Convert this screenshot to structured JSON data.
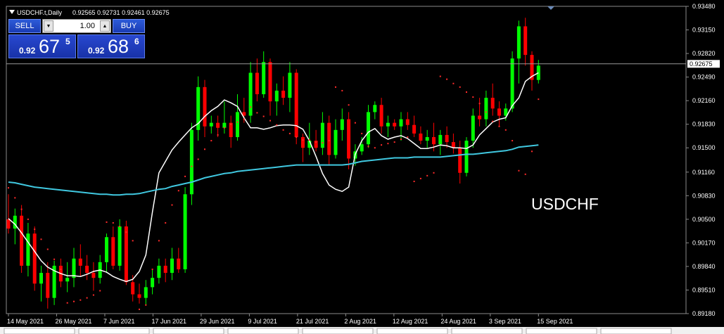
{
  "header": {
    "title": "USDCHF.t,Daily",
    "ohlc": "0.92565 0.92731 0.92461 0.92675"
  },
  "trade_panel": {
    "sell_label": "SELL",
    "buy_label": "BUY",
    "lot": "1.00",
    "sell_price": {
      "prefix": "0.92",
      "big": "67",
      "sup": "5"
    },
    "buy_price": {
      "prefix": "0.92",
      "big": "68",
      "sup": "6"
    }
  },
  "watermark": "USDCHF",
  "current_price_label": "0.92675",
  "colors": {
    "background": "#000000",
    "bull": "#00ff00",
    "bear": "#ff0000",
    "fast_ma": "#ffffff",
    "slow_ma": "#40c8e0",
    "sar": "#ff2a2a",
    "axis_text": "#ffffff"
  },
  "chart_data": {
    "type": "candlestick",
    "symbol": "USDCHF.t",
    "timeframe": "Daily",
    "ylim": [
      0.8918,
      0.9348
    ],
    "y_ticks": [
      "0.93480",
      "0.93150",
      "0.92820",
      "0.92490",
      "0.92160",
      "0.91830",
      "0.91500",
      "0.91160",
      "0.90830",
      "0.90500",
      "0.90170",
      "0.89840",
      "0.89510",
      "0.89180"
    ],
    "x_ticks": [
      "14 May 2021",
      "26 May 2021",
      "7 Jun 2021",
      "17 Jun 2021",
      "29 Jun 2021",
      "9 Jul 2021",
      "21 Jul 2021",
      "2 Aug 2021",
      "12 Aug 2021",
      "24 Aug 2021",
      "3 Sep 2021",
      "15 Sep 2021"
    ],
    "current_price": 0.92675,
    "series": [
      {
        "name": "fast_ma",
        "values": [
          0.9051,
          0.9043,
          0.9031,
          0.9018,
          0.9005,
          0.8992,
          0.8983,
          0.8978,
          0.8974,
          0.8971,
          0.8971,
          0.897,
          0.8973,
          0.8977,
          0.8979,
          0.8976,
          0.897,
          0.8966,
          0.8963,
          0.8966,
          0.8977,
          0.9,
          0.906,
          0.9115,
          0.9131,
          0.9147,
          0.9158,
          0.9168,
          0.9178,
          0.9184,
          0.9194,
          0.9202,
          0.9208,
          0.9217,
          0.9213,
          0.9208,
          0.9192,
          0.9178,
          0.9178,
          0.9176,
          0.9178,
          0.9181,
          0.9182,
          0.9182,
          0.9181,
          0.9176,
          0.916,
          0.9138,
          0.9114,
          0.9098,
          0.9092,
          0.9089,
          0.9095,
          0.9141,
          0.916,
          0.9172,
          0.9177,
          0.9167,
          0.9162,
          0.9165,
          0.9167,
          0.9163,
          0.9156,
          0.9149,
          0.9149,
          0.9151,
          0.9154,
          0.9153,
          0.915,
          0.915,
          0.9149,
          0.9154,
          0.9168,
          0.9177,
          0.9186,
          0.919,
          0.9192,
          0.9209,
          0.922,
          0.9243,
          0.925,
          0.9255
        ]
      },
      {
        "name": "slow_ma",
        "values": [
          0.9102,
          0.9101,
          0.9099,
          0.9097,
          0.9095,
          0.9094,
          0.9093,
          0.9092,
          0.9091,
          0.909,
          0.9089,
          0.9088,
          0.9087,
          0.9086,
          0.9085,
          0.9085,
          0.9084,
          0.9084,
          0.9085,
          0.9085,
          0.9086,
          0.9088,
          0.909,
          0.9092,
          0.9093,
          0.9096,
          0.9098,
          0.91,
          0.9102,
          0.9105,
          0.9108,
          0.911,
          0.9112,
          0.9114,
          0.9115,
          0.9117,
          0.9118,
          0.9119,
          0.912,
          0.9121,
          0.9122,
          0.9123,
          0.9124,
          0.9125,
          0.9126,
          0.9126,
          0.9126,
          0.9126,
          0.9126,
          0.9126,
          0.9126,
          0.9126,
          0.9127,
          0.9129,
          0.9131,
          0.9132,
          0.9133,
          0.9134,
          0.9135,
          0.9136,
          0.9136,
          0.9136,
          0.9137,
          0.9137,
          0.9137,
          0.9137,
          0.9137,
          0.9138,
          0.9139,
          0.914,
          0.9141,
          0.9141,
          0.9142,
          0.9143,
          0.9144,
          0.9145,
          0.9146,
          0.9148,
          0.9151,
          0.9152,
          0.9153,
          0.9154
        ]
      },
      {
        "name": "parabolic_sar",
        "values": [
          0.9094,
          0.908,
          0.9064,
          0.905,
          0.9036,
          0.9022,
          0.9008,
          0.8994,
          0.898,
          0.8933,
          0.8935,
          0.8937,
          0.894,
          0.8944,
          0.895,
          0.9046,
          0.9045,
          0.904,
          0.9032,
          0.902,
          0.8924,
          0.893,
          0.898,
          0.902,
          0.9045,
          0.907,
          0.909,
          0.911,
          0.9124,
          0.9134,
          0.9148,
          0.916,
          0.9168,
          0.9178,
          0.9183,
          0.9186,
          0.919,
          0.9207,
          0.9199,
          0.9194,
          0.9188,
          0.9182,
          0.9175,
          0.917,
          0.9165,
          0.9161,
          0.9161,
          0.9158,
          0.9157,
          0.916,
          0.9235,
          0.923,
          0.921,
          0.9185,
          0.917,
          0.9152,
          0.915,
          0.9154,
          0.9156,
          0.9158,
          0.9162,
          0.9165,
          0.9103,
          0.9107,
          0.9111,
          0.9115,
          0.925,
          0.9246,
          0.924,
          0.9235,
          0.9228,
          0.9221,
          0.9212,
          0.92,
          0.9187,
          0.918,
          0.9175,
          0.916,
          0.9118,
          0.9113,
          0.9145,
          0.9218
        ]
      }
    ],
    "candles": [
      {
        "o": 0.905,
        "h": 0.9085,
        "l": 0.903,
        "c": 0.9037
      },
      {
        "o": 0.9037,
        "h": 0.9065,
        "l": 0.9015,
        "c": 0.9055
      },
      {
        "o": 0.9055,
        "h": 0.907,
        "l": 0.8975,
        "c": 0.8985
      },
      {
        "o": 0.8985,
        "h": 0.9045,
        "l": 0.897,
        "c": 0.903
      },
      {
        "o": 0.903,
        "h": 0.904,
        "l": 0.895,
        "c": 0.896
      },
      {
        "o": 0.896,
        "h": 0.8985,
        "l": 0.8935,
        "c": 0.8975
      },
      {
        "o": 0.8975,
        "h": 0.899,
        "l": 0.8925,
        "c": 0.894
      },
      {
        "o": 0.894,
        "h": 0.8992,
        "l": 0.893,
        "c": 0.8985
      },
      {
        "o": 0.8985,
        "h": 0.8995,
        "l": 0.8955,
        "c": 0.8963
      },
      {
        "o": 0.8963,
        "h": 0.899,
        "l": 0.8948,
        "c": 0.8968
      },
      {
        "o": 0.8968,
        "h": 0.901,
        "l": 0.8955,
        "c": 0.8995
      },
      {
        "o": 0.8995,
        "h": 0.9015,
        "l": 0.897,
        "c": 0.8985
      },
      {
        "o": 0.8985,
        "h": 0.9,
        "l": 0.8965,
        "c": 0.8975
      },
      {
        "o": 0.8975,
        "h": 0.899,
        "l": 0.895,
        "c": 0.8968
      },
      {
        "o": 0.8968,
        "h": 0.9,
        "l": 0.896,
        "c": 0.899
      },
      {
        "o": 0.899,
        "h": 0.903,
        "l": 0.8975,
        "c": 0.9025
      },
      {
        "o": 0.9025,
        "h": 0.904,
        "l": 0.898,
        "c": 0.8985
      },
      {
        "o": 0.8985,
        "h": 0.905,
        "l": 0.8978,
        "c": 0.904
      },
      {
        "o": 0.904,
        "h": 0.9048,
        "l": 0.8958,
        "c": 0.8962
      },
      {
        "o": 0.8962,
        "h": 0.8972,
        "l": 0.8935,
        "c": 0.8945
      },
      {
        "o": 0.8945,
        "h": 0.896,
        "l": 0.8932,
        "c": 0.894
      },
      {
        "o": 0.894,
        "h": 0.8965,
        "l": 0.893,
        "c": 0.8955
      },
      {
        "o": 0.8955,
        "h": 0.898,
        "l": 0.8945,
        "c": 0.8968
      },
      {
        "o": 0.8968,
        "h": 0.8995,
        "l": 0.896,
        "c": 0.8985
      },
      {
        "o": 0.8985,
        "h": 0.8995,
        "l": 0.8962,
        "c": 0.8975
      },
      {
        "o": 0.8975,
        "h": 0.901,
        "l": 0.8965,
        "c": 0.8995
      },
      {
        "o": 0.8995,
        "h": 0.901,
        "l": 0.8975,
        "c": 0.898
      },
      {
        "o": 0.898,
        "h": 0.9095,
        "l": 0.8975,
        "c": 0.9085
      },
      {
        "o": 0.9085,
        "h": 0.9185,
        "l": 0.907,
        "c": 0.9175
      },
      {
        "o": 0.9175,
        "h": 0.925,
        "l": 0.916,
        "c": 0.9235
      },
      {
        "o": 0.9235,
        "h": 0.9245,
        "l": 0.9165,
        "c": 0.918
      },
      {
        "o": 0.918,
        "h": 0.9195,
        "l": 0.917,
        "c": 0.9185
      },
      {
        "o": 0.9185,
        "h": 0.9195,
        "l": 0.9165,
        "c": 0.9178
      },
      {
        "o": 0.9178,
        "h": 0.9215,
        "l": 0.917,
        "c": 0.9185
      },
      {
        "o": 0.9185,
        "h": 0.9195,
        "l": 0.915,
        "c": 0.9165
      },
      {
        "o": 0.9165,
        "h": 0.9225,
        "l": 0.916,
        "c": 0.92
      },
      {
        "o": 0.92,
        "h": 0.922,
        "l": 0.9185,
        "c": 0.9195
      },
      {
        "o": 0.9195,
        "h": 0.927,
        "l": 0.9185,
        "c": 0.9255
      },
      {
        "o": 0.9255,
        "h": 0.9275,
        "l": 0.9215,
        "c": 0.9225
      },
      {
        "o": 0.9225,
        "h": 0.9285,
        "l": 0.922,
        "c": 0.927
      },
      {
        "o": 0.927,
        "h": 0.9275,
        "l": 0.9195,
        "c": 0.9215
      },
      {
        "o": 0.9215,
        "h": 0.924,
        "l": 0.9195,
        "c": 0.923
      },
      {
        "o": 0.923,
        "h": 0.925,
        "l": 0.921,
        "c": 0.922
      },
      {
        "o": 0.922,
        "h": 0.927,
        "l": 0.92,
        "c": 0.9255
      },
      {
        "o": 0.9255,
        "h": 0.926,
        "l": 0.9155,
        "c": 0.9165
      },
      {
        "o": 0.9165,
        "h": 0.917,
        "l": 0.913,
        "c": 0.915
      },
      {
        "o": 0.915,
        "h": 0.9185,
        "l": 0.914,
        "c": 0.916
      },
      {
        "o": 0.916,
        "h": 0.9175,
        "l": 0.9145,
        "c": 0.915
      },
      {
        "o": 0.915,
        "h": 0.92,
        "l": 0.914,
        "c": 0.9185
      },
      {
        "o": 0.9185,
        "h": 0.9195,
        "l": 0.9125,
        "c": 0.914
      },
      {
        "o": 0.914,
        "h": 0.919,
        "l": 0.9135,
        "c": 0.9175
      },
      {
        "o": 0.9175,
        "h": 0.9205,
        "l": 0.916,
        "c": 0.919
      },
      {
        "o": 0.919,
        "h": 0.92,
        "l": 0.912,
        "c": 0.9135
      },
      {
        "o": 0.9135,
        "h": 0.9155,
        "l": 0.9125,
        "c": 0.9145
      },
      {
        "o": 0.9145,
        "h": 0.9165,
        "l": 0.914,
        "c": 0.9155
      },
      {
        "o": 0.9155,
        "h": 0.921,
        "l": 0.915,
        "c": 0.92
      },
      {
        "o": 0.92,
        "h": 0.9215,
        "l": 0.919,
        "c": 0.921
      },
      {
        "o": 0.921,
        "h": 0.922,
        "l": 0.917,
        "c": 0.918
      },
      {
        "o": 0.918,
        "h": 0.9195,
        "l": 0.9165,
        "c": 0.9185
      },
      {
        "o": 0.9185,
        "h": 0.919,
        "l": 0.9175,
        "c": 0.918
      },
      {
        "o": 0.918,
        "h": 0.92,
        "l": 0.916,
        "c": 0.919
      },
      {
        "o": 0.919,
        "h": 0.92,
        "l": 0.9175,
        "c": 0.9182
      },
      {
        "o": 0.9182,
        "h": 0.9195,
        "l": 0.9165,
        "c": 0.917
      },
      {
        "o": 0.917,
        "h": 0.918,
        "l": 0.9155,
        "c": 0.916
      },
      {
        "o": 0.916,
        "h": 0.9175,
        "l": 0.915,
        "c": 0.9165
      },
      {
        "o": 0.9165,
        "h": 0.9185,
        "l": 0.9145,
        "c": 0.9155
      },
      {
        "o": 0.9155,
        "h": 0.9175,
        "l": 0.914,
        "c": 0.9168
      },
      {
        "o": 0.9168,
        "h": 0.918,
        "l": 0.915,
        "c": 0.9158
      },
      {
        "o": 0.9158,
        "h": 0.917,
        "l": 0.9142,
        "c": 0.915
      },
      {
        "o": 0.915,
        "h": 0.916,
        "l": 0.91,
        "c": 0.9115
      },
      {
        "o": 0.9115,
        "h": 0.9165,
        "l": 0.911,
        "c": 0.916
      },
      {
        "o": 0.916,
        "h": 0.9205,
        "l": 0.915,
        "c": 0.9195
      },
      {
        "o": 0.9195,
        "h": 0.922,
        "l": 0.918,
        "c": 0.919
      },
      {
        "o": 0.919,
        "h": 0.923,
        "l": 0.918,
        "c": 0.922
      },
      {
        "o": 0.922,
        "h": 0.924,
        "l": 0.9195,
        "c": 0.9205
      },
      {
        "o": 0.9205,
        "h": 0.9215,
        "l": 0.918,
        "c": 0.9195
      },
      {
        "o": 0.9195,
        "h": 0.9212,
        "l": 0.9188,
        "c": 0.9205
      },
      {
        "o": 0.9205,
        "h": 0.9285,
        "l": 0.92,
        "c": 0.9275
      },
      {
        "o": 0.9275,
        "h": 0.9328,
        "l": 0.924,
        "c": 0.932
      },
      {
        "o": 0.932,
        "h": 0.9332,
        "l": 0.9265,
        "c": 0.928
      },
      {
        "o": 0.928,
        "h": 0.9285,
        "l": 0.923,
        "c": 0.9245
      },
      {
        "o": 0.9245,
        "h": 0.9273,
        "l": 0.924,
        "c": 0.9265
      }
    ]
  }
}
